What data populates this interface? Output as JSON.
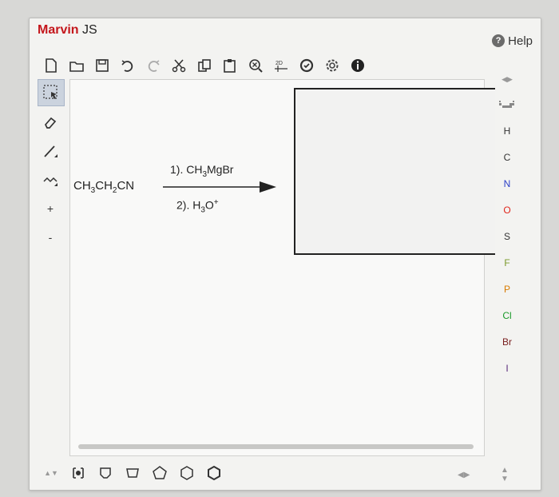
{
  "app": {
    "title_part1": "Marvin",
    "title_part2": "JS",
    "help_label": "Help"
  },
  "reaction": {
    "reactant_parts": [
      "CH",
      "3",
      "CH",
      "2",
      "CN"
    ],
    "condition1_parts": [
      "1). CH",
      "3",
      "MgBr"
    ],
    "condition2_parts": [
      "2). H",
      "3",
      "O",
      "+"
    ]
  },
  "elements": [
    "H",
    "C",
    "N",
    "O",
    "S",
    "F",
    "P",
    "Cl",
    "Br",
    "I"
  ],
  "element_colors": {
    "H": "#333333",
    "C": "#333333",
    "N": "#2b3fc7",
    "O": "#e0261c",
    "S": "#333333",
    "F": "#7a9a2a",
    "P": "#d97c00",
    "Cl": "#1a9a2a",
    "Br": "#7a2020",
    "I": "#5a2a7a"
  },
  "left_tools": {
    "charge_plus": "+",
    "charge_minus": "-"
  },
  "colors": {
    "brand_red": "#c4161c",
    "selection_bg": "#cbd3de"
  }
}
